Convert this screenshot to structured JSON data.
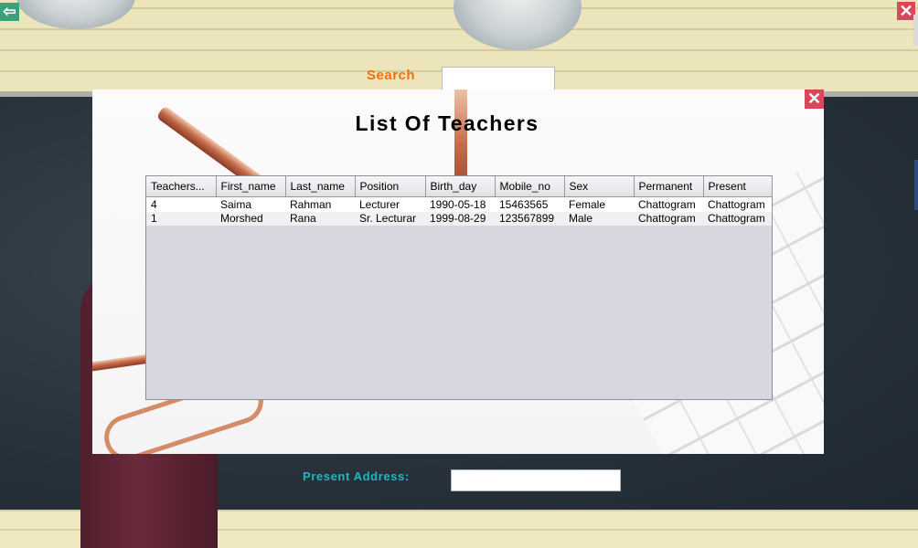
{
  "window": {
    "back_icon": "arrow-left-icon",
    "back_glyph": "⇦",
    "close_icon": "close-icon",
    "close_glyph": "✕"
  },
  "search": {
    "label": "Search",
    "value": ""
  },
  "present_address": {
    "label": "Present Address:",
    "value": ""
  },
  "dialog": {
    "title": "List Of Teachers",
    "close_icon": "close-icon",
    "close_glyph": "✕"
  },
  "table": {
    "columns": [
      "Teachers...",
      "First_name",
      "Last_name",
      "Position",
      "Birth_day",
      "Mobile_no",
      "Sex",
      "Permanent",
      "Present"
    ],
    "rows": [
      [
        "4",
        "Saima",
        "Rahman",
        "Lecturer",
        "1990-05-18",
        "15463565",
        "Female",
        "Chattogram",
        "Chattogram"
      ],
      [
        "1",
        "Morshed",
        "Rana",
        "Sr. Lecturar",
        "1999-08-29",
        "123567899",
        "Male",
        "Chattogram",
        "Chattogram"
      ]
    ]
  },
  "colors": {
    "search_label": "#f07010",
    "present_label": "#1fb7c4",
    "close_button": "#d9475a",
    "back_button": "#3aa17a"
  }
}
